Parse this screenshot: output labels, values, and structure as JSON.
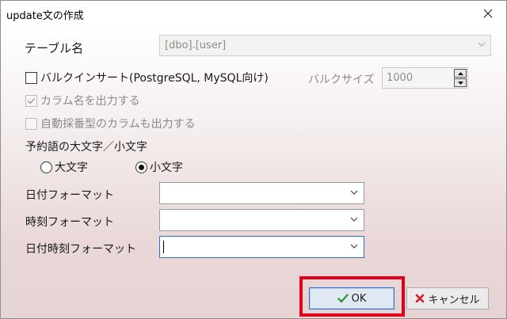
{
  "window": {
    "title": "update文の作成",
    "close_icon": "close-icon"
  },
  "form": {
    "table_name_label": "テーブル名",
    "table_name_value": "[dbo].[user]",
    "bulk_insert_label": "バルクインサート(PostgreSQL, MySQL向け)",
    "bulk_insert_checked": false,
    "bulk_size_label": "バルクサイズ",
    "bulk_size_value": "1000",
    "output_column_names_label": "カラム名を出力する",
    "output_column_names_checked": true,
    "output_auto_number_label": "自動採番型のカラムも出力する",
    "output_auto_number_checked": false,
    "reserved_word_case_label": "予約語の大文字／小文字",
    "uppercase_label": "大文字",
    "lowercase_label": "小文字",
    "case_selected": "lowercase",
    "date_format_label": "日付フォーマット",
    "date_format_value": "",
    "time_format_label": "時刻フォーマット",
    "time_format_value": "",
    "datetime_format_label": "日付時刻フォーマット",
    "datetime_format_value": ""
  },
  "buttons": {
    "ok_label": "OK",
    "cancel_label": "キャンセル"
  },
  "colors": {
    "ok_check": "#2e9e3a",
    "cancel_x": "#d21f2b",
    "highlight": "#e0001a",
    "focus_border": "#2d6fd1"
  }
}
